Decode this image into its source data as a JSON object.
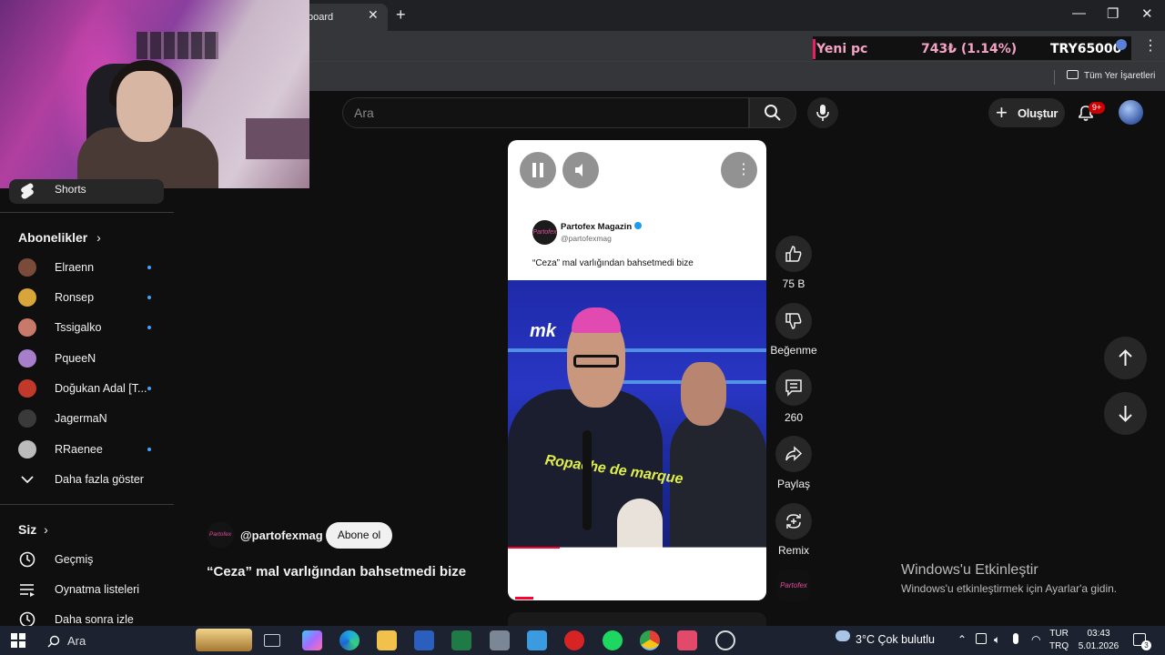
{
  "browser": {
    "tab_title": "board",
    "bookmark_folder": "Tüm Yer İşaretleri"
  },
  "ticker": {
    "label": "Yeni pc",
    "amount": "743₺ (1.14%)",
    "goal": "TRY65000"
  },
  "header": {
    "search_placeholder": "Ara",
    "create_label": "Oluştur",
    "notification_count": "9+"
  },
  "sidebar": {
    "shorts_label": "Shorts",
    "subscriptions_title": "Abonelikler",
    "subscriptions": [
      {
        "name": "Elraenn",
        "new": true,
        "color": "#7a4a3a"
      },
      {
        "name": "Ronsep",
        "new": true,
        "color": "#d8a53a"
      },
      {
        "name": "Tssigalko",
        "new": true,
        "color": "#c9796a"
      },
      {
        "name": "PqueeN",
        "new": false,
        "color": "#a77ec9"
      },
      {
        "name": "Doğukan Adal [T...",
        "new": true,
        "color": "#c0392b"
      },
      {
        "name": "JagermaN",
        "new": false,
        "color": "#3a3a3a"
      },
      {
        "name": "RRaenee",
        "new": true,
        "color": "#bbbbbb"
      }
    ],
    "show_more": "Daha fazla göster",
    "you_title": "Siz",
    "you_items": [
      "Geçmiş",
      "Oynatma listeleri",
      "Daha sonra izle"
    ]
  },
  "short": {
    "tweet_author": "Partofex Magazin",
    "tweet_handle": "@partofexmag",
    "tweet_text": "“Ceza” mal varlığından bahsetmedi bize",
    "avatar_text": "Partofex",
    "scene_logo": "mk",
    "shirt_text": "Ropache de marque"
  },
  "actions": {
    "like_count": "75 B",
    "dislike_label": "Beğenme",
    "comment_count": "260",
    "share_label": "Paylaş",
    "remix_label": "Remix"
  },
  "channel": {
    "handle": "@partofexmag",
    "subscribe_label": "Abone ol",
    "title": "“Ceza” mal varlığından bahsetmedi bize",
    "avatar_text": "Partofex"
  },
  "activation": {
    "title": "Windows'u Etkinleştir",
    "subtitle": "Windows'u etkinleştirmek için Ayarlar'a gidin."
  },
  "taskbar": {
    "search_label": "Ara",
    "weather": "3°C  Çok bulutlu",
    "lang_top": "TUR",
    "lang_bottom": "TRQ",
    "time": "03:43",
    "date": "5.01.2026",
    "notification_count": "3"
  }
}
